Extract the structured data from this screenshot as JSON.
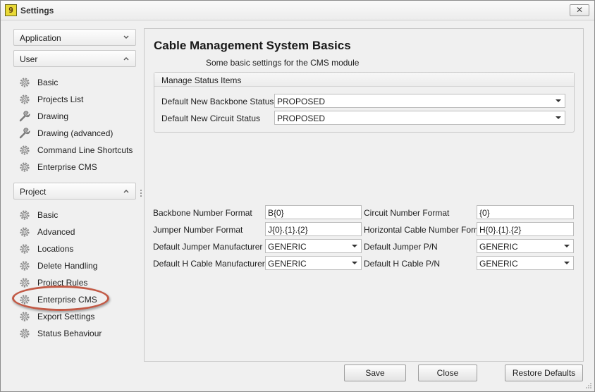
{
  "window": {
    "title": "Settings",
    "app_icon_text": "9",
    "close_glyph": "✕"
  },
  "nav": {
    "groups": [
      {
        "label": "Application",
        "state": "collapsed",
        "items": []
      },
      {
        "label": "User",
        "state": "expanded",
        "items": [
          {
            "label": "Basic",
            "icon": "gear-icon"
          },
          {
            "label": "Projects List",
            "icon": "gear-icon"
          },
          {
            "label": "Drawing",
            "icon": "wrench-icon"
          },
          {
            "label": "Drawing (advanced)",
            "icon": "wrench-icon"
          },
          {
            "label": "Command Line Shortcuts",
            "icon": "gear-icon"
          },
          {
            "label": "Enterprise CMS",
            "icon": "gear-icon"
          }
        ]
      },
      {
        "label": "Project",
        "state": "expanded",
        "items": [
          {
            "label": "Basic",
            "icon": "gear-icon"
          },
          {
            "label": "Advanced",
            "icon": "gear-icon"
          },
          {
            "label": "Locations",
            "icon": "gear-icon"
          },
          {
            "label": "Delete Handling",
            "icon": "gear-icon"
          },
          {
            "label": "Project Rules",
            "icon": "gear-icon"
          },
          {
            "label": "Enterprise CMS",
            "icon": "gear-icon",
            "highlighted": true
          },
          {
            "label": "Export Settings",
            "icon": "gear-icon"
          },
          {
            "label": "Status Behaviour",
            "icon": "gear-icon"
          }
        ]
      }
    ]
  },
  "content": {
    "title": "Cable Management System Basics",
    "subtitle": "Some basic settings for the CMS module",
    "status_group": {
      "title": "Manage Status Items",
      "fields": [
        {
          "label": "Default New Backbone Status",
          "value": "PROPOSED"
        },
        {
          "label": "Default New Circuit Status",
          "value": "PROPOSED"
        }
      ]
    },
    "formats": {
      "left": [
        {
          "label": "Backbone Number Format",
          "value": "B{0}",
          "type": "text"
        },
        {
          "label": "Jumper Number Format",
          "value": "J{0}.{1}.{2}",
          "type": "text"
        },
        {
          "label": "Default Jumper Manufacturer",
          "value": "GENERIC",
          "type": "combo"
        },
        {
          "label": "Default H Cable Manufacturer",
          "value": "GENERIC",
          "type": "combo"
        }
      ],
      "right": [
        {
          "label": "Circuit Number Format",
          "value": "{0}",
          "type": "text"
        },
        {
          "label": "Horizontal Cable Number Format",
          "value": "H{0}.{1}.{2}",
          "type": "text"
        },
        {
          "label": "Default Jumper P/N",
          "value": "GENERIC",
          "type": "combo"
        },
        {
          "label": "Default H Cable P/N",
          "value": "GENERIC",
          "type": "combo"
        }
      ]
    }
  },
  "buttons": {
    "save": "Save",
    "close": "Close",
    "restore": "Restore Defaults"
  },
  "colors": {
    "highlight_ring": "#c25a46",
    "app_icon": "#e9d936"
  }
}
